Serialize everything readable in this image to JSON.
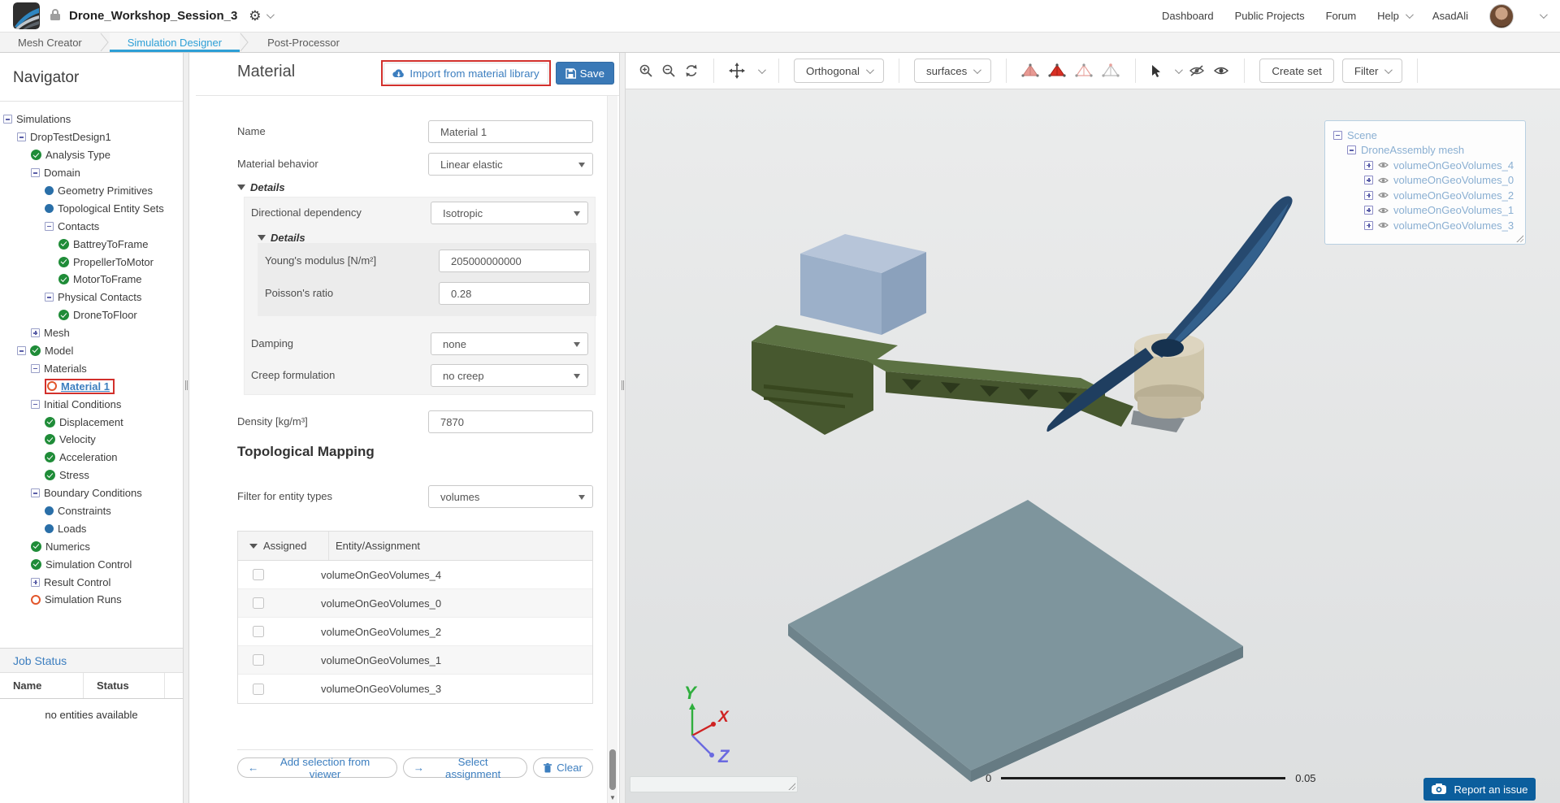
{
  "topbar": {
    "title": "Drone_Workshop_Session_3",
    "nav": [
      "Dashboard",
      "Public Projects",
      "Forum",
      "Help",
      "AsadAli"
    ],
    "help_has_chevron": true
  },
  "tabs": [
    {
      "label": "Mesh Creator",
      "active": false
    },
    {
      "label": "Simulation Designer",
      "active": true
    },
    {
      "label": "Post-Processor",
      "active": false
    }
  ],
  "navigator": {
    "title": "Navigator",
    "items": [
      {
        "label": "Simulations",
        "icons": [
          "minus"
        ],
        "level": 0
      },
      {
        "label": "DropTestDesign1",
        "icons": [
          "minus"
        ],
        "level": 1
      },
      {
        "label": "Analysis Type",
        "icons": [
          "check"
        ],
        "level": 2
      },
      {
        "label": "Domain",
        "icons": [
          "minus"
        ],
        "level": 2
      },
      {
        "label": "Geometry Primitives",
        "icons": [
          "dot"
        ],
        "level": 3
      },
      {
        "label": "Topological Entity Sets",
        "icons": [
          "dot"
        ],
        "level": 3
      },
      {
        "label": "Contacts",
        "icons": [
          "minus"
        ],
        "level": 3
      },
      {
        "label": "BattreyToFrame",
        "icons": [
          "check"
        ],
        "level": 4
      },
      {
        "label": "PropellerToMotor",
        "icons": [
          "check"
        ],
        "level": 4
      },
      {
        "label": "MotorToFrame",
        "icons": [
          "check"
        ],
        "level": 4
      },
      {
        "label": "Physical Contacts",
        "icons": [
          "minus"
        ],
        "level": 3
      },
      {
        "label": "DroneToFloor",
        "icons": [
          "check"
        ],
        "level": 4
      },
      {
        "label": "Mesh",
        "icons": [
          "plus"
        ],
        "level": 2
      },
      {
        "label": "Model",
        "icons": [
          "minus",
          "check"
        ],
        "level": 1
      },
      {
        "label": "Materials",
        "icons": [
          "minus"
        ],
        "level": 2
      },
      {
        "label": "Material 1",
        "icons": [
          "warn"
        ],
        "level": 3,
        "selected": true
      },
      {
        "label": "Initial Conditions",
        "icons": [
          "minus"
        ],
        "level": 2
      },
      {
        "label": "Displacement",
        "icons": [
          "check"
        ],
        "level": 3
      },
      {
        "label": "Velocity",
        "icons": [
          "check"
        ],
        "level": 3
      },
      {
        "label": "Acceleration",
        "icons": [
          "check"
        ],
        "level": 3
      },
      {
        "label": "Stress",
        "icons": [
          "check"
        ],
        "level": 3
      },
      {
        "label": "Boundary Conditions",
        "icons": [
          "minus"
        ],
        "level": 2
      },
      {
        "label": "Constraints",
        "icons": [
          "dot"
        ],
        "level": 3
      },
      {
        "label": "Loads",
        "icons": [
          "dot"
        ],
        "level": 3
      },
      {
        "label": "Numerics",
        "icons": [
          "check"
        ],
        "level": 2
      },
      {
        "label": "Simulation Control",
        "icons": [
          "check"
        ],
        "level": 2
      },
      {
        "label": "Result Control",
        "icons": [
          "plus"
        ],
        "level": 2
      },
      {
        "label": "Simulation Runs",
        "icons": [
          "warn"
        ],
        "level": 2
      }
    ]
  },
  "job_status": {
    "title": "Job Status",
    "columns": [
      "Name",
      "Status"
    ],
    "empty_text": "no entities available"
  },
  "material": {
    "title": "Material",
    "import_label": "Import from material library",
    "save_label": "Save",
    "name_label": "Name",
    "name_value": "Material 1",
    "behavior_label": "Material behavior",
    "behavior_value": "Linear elastic",
    "details_label": "Details",
    "directional_label": "Directional dependency",
    "directional_value": "Isotropic",
    "inner_details_label": "Details",
    "youngs_label": "Young's modulus [N/m²]",
    "youngs_value": "205000000000",
    "poisson_label": "Poisson's ratio",
    "poisson_value": "0.28",
    "damping_label": "Damping",
    "damping_value": "none",
    "creep_label": "Creep formulation",
    "creep_value": "no creep",
    "density_label": "Density [kg/m³]",
    "density_value": "7870",
    "topo_title": "Topological Mapping",
    "filter_label": "Filter for entity types",
    "filter_value": "volumes",
    "table": {
      "col_assigned": "Assigned",
      "col_entity": "Entity/Assignment",
      "rows": [
        "volumeOnGeoVolumes_4",
        "volumeOnGeoVolumes_0",
        "volumeOnGeoVolumes_2",
        "volumeOnGeoVolumes_1",
        "volumeOnGeoVolumes_3"
      ]
    },
    "buttons": {
      "add_selection": "Add selection from viewer",
      "select_assignment": "Select assignment",
      "clear": "Clear"
    }
  },
  "viewer": {
    "toolbar": {
      "projection": "Orthogonal",
      "render_mode": "surfaces",
      "create_set": "Create set",
      "filter": "Filter"
    },
    "scene_tree": {
      "root": "Scene",
      "mesh": "DroneAssembly mesh",
      "volumes": [
        "volumeOnGeoVolumes_4",
        "volumeOnGeoVolumes_0",
        "volumeOnGeoVolumes_2",
        "volumeOnGeoVolumes_1",
        "volumeOnGeoVolumes_3"
      ]
    },
    "axes": {
      "x": "X",
      "y": "Y",
      "z": "Z"
    },
    "axis_colors": {
      "x": "#cf2222",
      "y": "#2fae3d",
      "z": "#6a6ae0"
    },
    "scale_bar": {
      "start": "0",
      "end": "0.05"
    },
    "report_label": "Report an issue"
  }
}
